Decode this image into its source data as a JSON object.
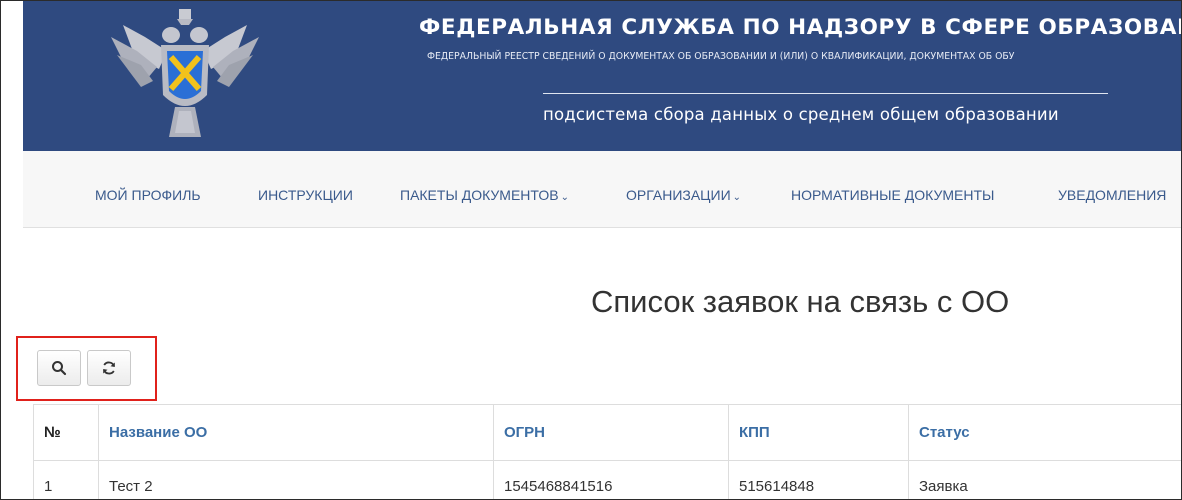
{
  "header": {
    "title": "ФЕДЕРАЛЬНАЯ СЛУЖБА ПО НАДЗОРУ В СФЕРЕ ОБРАЗОВАНИЯ И НА",
    "subtitle": "ФЕДЕРАЛЬНЫЙ РЕЕСТР СВЕДЕНИЙ О ДОКУМЕНТАХ ОБ ОБРАЗОВАНИИ И (ИЛИ) О КВАЛИФИКАЦИИ, ДОКУМЕНТАХ ОБ ОБУ",
    "subsystem": "подсистема сбора данных о среднем общем образовании"
  },
  "nav": {
    "items": [
      {
        "label": "МОЙ ПРОФИЛЬ",
        "dropdown": false
      },
      {
        "label": "ИНСТРУКЦИИ",
        "dropdown": false
      },
      {
        "label": "ПАКЕТЫ ДОКУМЕНТОВ",
        "dropdown": true
      },
      {
        "label": "ОРГАНИЗАЦИИ",
        "dropdown": true
      },
      {
        "label": "НОРМАТИВНЫЕ ДОКУМЕНТЫ",
        "dropdown": false
      },
      {
        "label": "УВЕДОМЛЕНИЯ",
        "dropdown": false
      }
    ],
    "chevron": "⌄"
  },
  "page": {
    "title": "Список заявок на связь с ОО"
  },
  "toolbar": {
    "search_icon": "search-icon",
    "refresh_icon": "refresh-icon",
    "highlight_color": "#e0211b"
  },
  "table": {
    "headers": [
      "№",
      "Название ОО",
      "ОГРН",
      "КПП",
      "Статус"
    ],
    "rows": [
      [
        "1",
        "Тест 2",
        "1545468841516",
        "515614848",
        "Заявка"
      ]
    ]
  },
  "colors": {
    "header_bg": "#2f4a80",
    "nav_link": "#3a5a8c",
    "table_header_link": "#3b6ea5"
  }
}
